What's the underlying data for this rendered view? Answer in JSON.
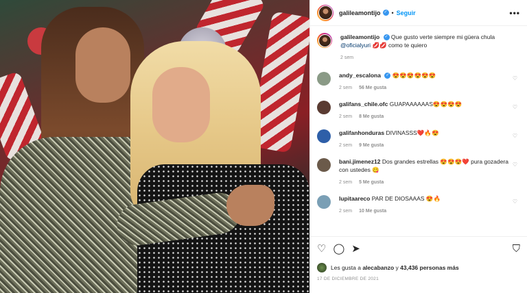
{
  "post": {
    "author": "galileamontijo",
    "follow_label": "Seguir",
    "separator": "•",
    "more_icon": "more-horizontal-icon",
    "more_label": "•••"
  },
  "caption": {
    "user": "galileamontijo",
    "text_before": "Que gusto verte siempre mi güera chula",
    "mention": "@oficialyuri",
    "text_after": "💋💋 como te quiero",
    "time": "2 sem"
  },
  "comments": [
    {
      "user": "andy_escalona",
      "verified": true,
      "text": "😍😍😍😍😍😍",
      "time": "2 sem",
      "likes": "56 Me gusta",
      "avatar_color": "#8a9a86"
    },
    {
      "user": "galifans_chile.ofc",
      "verified": false,
      "text": "GUAPAAAAAAS😍😍😍😍",
      "time": "2 sem",
      "likes": "8 Me gusta",
      "avatar_color": "#5a3b32"
    },
    {
      "user": "galifanhonduras",
      "verified": false,
      "text": "DIVINASSS❤️🔥😍",
      "time": "2 sem",
      "likes": "9 Me gusta",
      "avatar_color": "#2e5fa8"
    },
    {
      "user": "bani.jimenez12",
      "verified": false,
      "text": "Dos grandes estrellas 😍😍😍❤️ pura gozadera con ustedes 😋",
      "time": "2 sem",
      "likes": "5 Me gusta",
      "avatar_color": "#6b5a4a"
    },
    {
      "user": "lupitaareco",
      "verified": false,
      "text": "PAR DE DIOSAAAS 😍🔥",
      "time": "2 sem",
      "likes": "10 Me gusta",
      "avatar_color": "#7a9fb5"
    }
  ],
  "actions": {
    "like_icon": "heart-icon",
    "comment_icon": "comment-icon",
    "share_icon": "send-icon",
    "save_icon": "bookmark-icon"
  },
  "likes_summary": {
    "prefix": "Les gusta a",
    "user": "alecabanzo",
    "connector": "y",
    "others": "43,436 personas más"
  },
  "date": "17 DE DICIEMBRE DE 2021"
}
